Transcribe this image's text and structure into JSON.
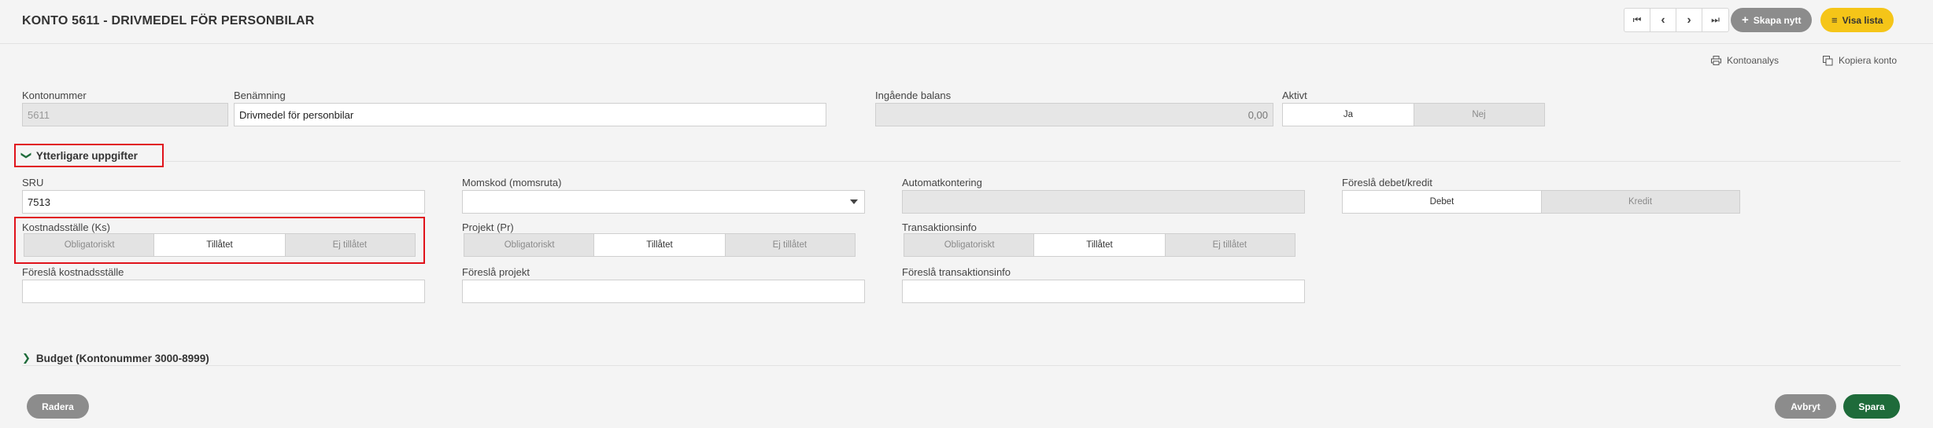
{
  "header": {
    "title": "KONTO 5611 - DRIVMEDEL FÖR PERSONBILAR",
    "nav": {
      "first": "⏮",
      "prev": "‹",
      "next": "›",
      "last": "⏭"
    },
    "create_label": "Skapa nytt",
    "list_label": "Visa lista",
    "colors": {
      "create": "#8c8c8c",
      "list": "#f5c518"
    }
  },
  "toolbar": {
    "analysis_label": "Kontoanalys",
    "copy_label": "Kopiera konto",
    "analysis_icon": "printer-icon",
    "copy_icon": "copy-icon"
  },
  "main": {
    "account_number": {
      "label": "Kontonummer",
      "value": "5611"
    },
    "name": {
      "label": "Benämning",
      "value": "Drivmedel för personbilar"
    },
    "opening_balance": {
      "label": "Ingående balans",
      "value": "0,00"
    },
    "active": {
      "label": "Aktivt",
      "options": [
        "Ja",
        "Nej"
      ],
      "selected": "Ja"
    }
  },
  "additional": {
    "title": "Ytterligare uppgifter",
    "sru": {
      "label": "SRU",
      "value": "7513"
    },
    "vat_code": {
      "label": "Momskod (momsruta)",
      "value": ""
    },
    "auto_posting": {
      "label": "Automatkontering",
      "value": ""
    },
    "suggest_debit_credit": {
      "label": "Föreslå debet/kredit",
      "options": [
        "Debet",
        "Kredit"
      ],
      "selected": "Debet"
    },
    "cost_center": {
      "label": "Kostnadsställe (Ks)",
      "options": [
        "Obligatoriskt",
        "Tillåtet",
        "Ej tillåtet"
      ],
      "selected": "Tillåtet"
    },
    "project": {
      "label": "Projekt (Pr)",
      "options": [
        "Obligatoriskt",
        "Tillåtet",
        "Ej tillåtet"
      ],
      "selected": "Tillåtet"
    },
    "transaction_info": {
      "label": "Transaktionsinfo",
      "options": [
        "Obligatoriskt",
        "Tillåtet",
        "Ej tillåtet"
      ],
      "selected": "Tillåtet"
    },
    "suggest_cost_center": {
      "label": "Föreslå kostnadsställe",
      "value": ""
    },
    "suggest_project": {
      "label": "Föreslå projekt",
      "value": ""
    },
    "suggest_transaction_info": {
      "label": "Föreslå transaktionsinfo",
      "value": ""
    }
  },
  "budget": {
    "title": "Budget (Kontonummer 3000-8999)"
  },
  "footer": {
    "delete_label": "Radera",
    "cancel_label": "Avbryt",
    "save_label": "Spara",
    "colors": {
      "delete": "#8c8c8c",
      "cancel": "#8c8c8c",
      "save": "#1e6b3a",
      "highlight": "#e0121b",
      "accent_chevron": "#1e6b3a"
    }
  }
}
